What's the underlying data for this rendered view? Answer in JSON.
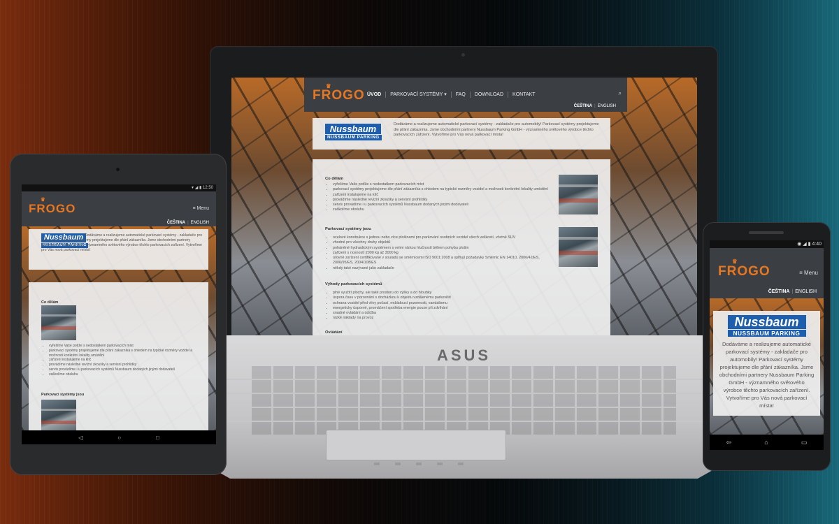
{
  "site": {
    "logo": "FROGO",
    "crown": "♛",
    "nav": [
      "ÚVOD",
      "PARKOVACÍ SYSTÉMY",
      "FAQ",
      "DOWNLOAD",
      "KONTAKT"
    ],
    "nav_dropdown_caret": "▾",
    "search_icon": "⌕",
    "lang_cs": "ČEŠTINA",
    "lang_en": "ENGLISH",
    "lang_sep": "|",
    "menu_label": "Menu",
    "menu_icon": "≡",
    "nuss_title": "Nussbaum",
    "nuss_sub": "NUSSBAUM PARKING",
    "intro_text": "Dodáváme a realizujeme automatické parkovací systémy - zakladače pro automobily! Parkovací systémy projektujeme dle přání zákazníka. Jsme obchodními partnery Nussbaum Parking GmbH - významného světového výrobce těchto parkovacích zařízení. Vytvoříme pro Vás nová parkovací místa!",
    "sections": [
      {
        "title": "Co dělám",
        "items": [
          "vyřešíme Vaše potíže s nedostatkem parkovacích míst",
          "parkovací systémy projektujeme dle přání zákazníka s ohledem na typické rozměry vozidel a možnosti konkrétní lokality umístění",
          "zařízení instalujeme na klíč",
          "provádíme následné revizní zkoušky a servisní prohlídky",
          "servis provádíme i u parkovacích systémů Nussbaum dodaných jinými dodavateli",
          "zaškolíme obsluhu"
        ]
      },
      {
        "title": "Parkovací systémy jsou",
        "items": [
          "ocelové konstrukce s jednou nebo více plošinami pro parkování osobních vozidel všech velikostí, včetně SUV",
          "vhodné pro všechny druhy objektů",
          "poháněné hydraulickým systémem s velmi nízkou hlučností během pohybu plošin",
          "zařízení s nosností 2000 kg až 3000 kg",
          "úrovně zařízení certifikované v souladu se směrnicemi ISO 9001:2008 a splňují požadavky Směrnic EN 14010, 2006/42/ES, 2006/95/ES, 2004/108/ES",
          "někdy také nazývané jako zakladače"
        ]
      },
      {
        "title": "Výhody parkovacích systémů",
        "items": [
          "plné využití plochy, ale také prostoru do výšky a do hloubky",
          "úspora času v porovnání s docházkou k objektu vzdálenému parkovišti",
          "ochrana vozidel před vlivy počasí, nežádoucí pozornosti, vandalismu",
          "energeticky úsporné, promáčení spotřeba energie pouze při zdvíhání",
          "snadné ovládání a údržba",
          "nízké náklady na provoz"
        ]
      },
      {
        "title": "Ovládání",
        "items": []
      }
    ]
  },
  "laptop": {
    "brand": "ASUS"
  },
  "tablet": {
    "status_time": "12:50",
    "status_icons": "▾ ◢ ▮",
    "nav_back": "◁",
    "nav_home": "○",
    "nav_recent": "□"
  },
  "phone": {
    "status_time": "4:40",
    "status_icons": "◉ ◢ ▮",
    "nav_back": "⇦",
    "nav_home": "⌂",
    "nav_recent": "▭"
  }
}
